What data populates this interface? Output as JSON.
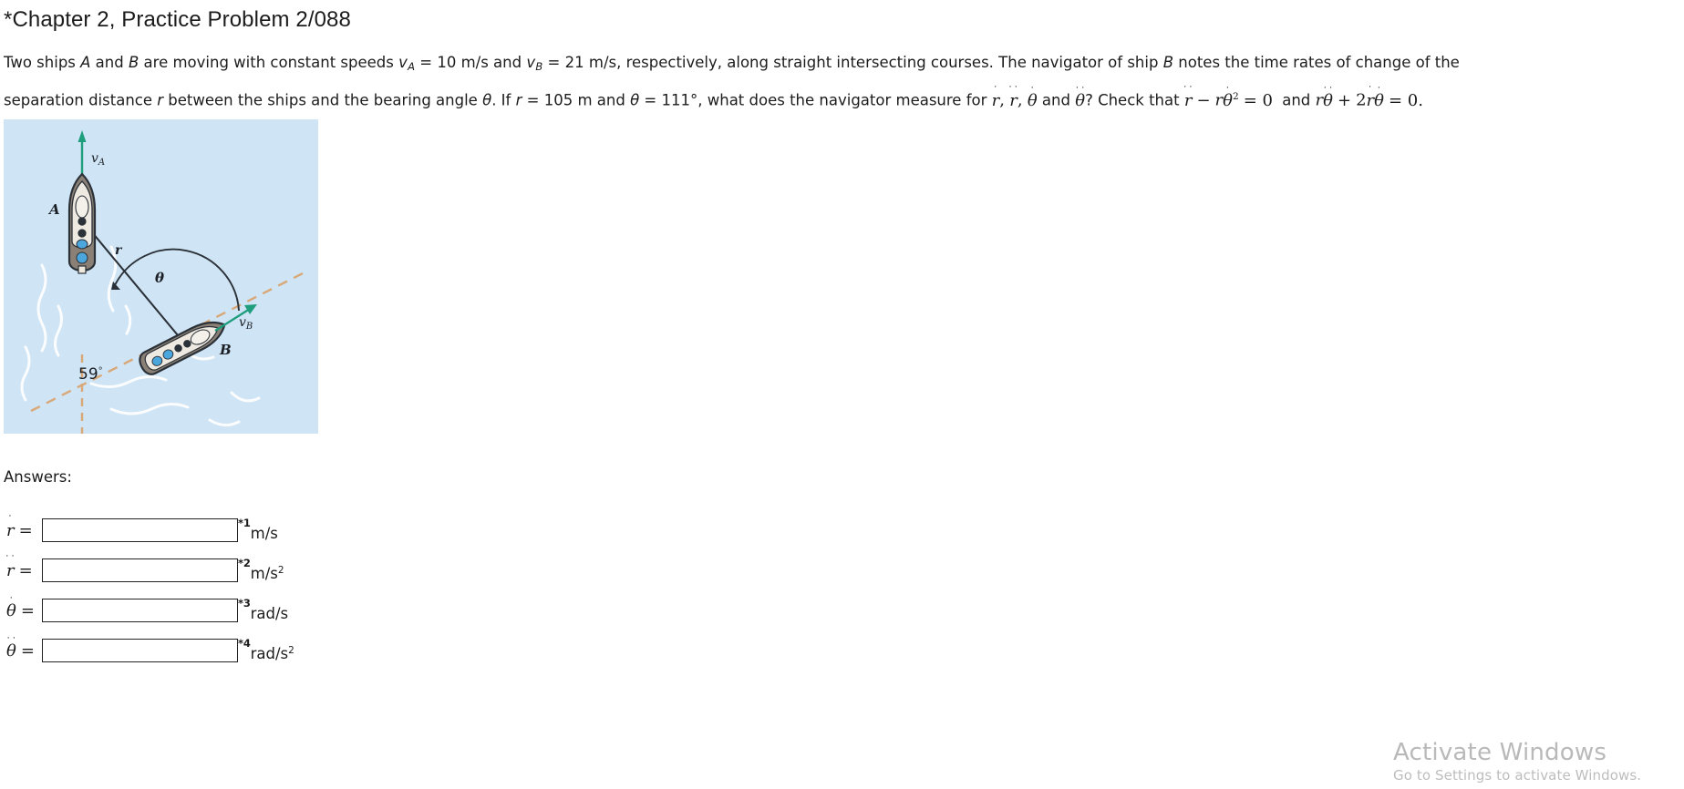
{
  "title": "*Chapter 2, Practice Problem 2/088",
  "problem": {
    "seg1": "Two ships ",
    "shipA": "A",
    "seg2": " and ",
    "shipB": "B",
    "seg3": " are moving with constant speeds ",
    "vA_var": "v",
    "vA_sub": "A",
    "seg4": " = 10 m/s and ",
    "vB_var": "v",
    "vB_sub": "B",
    "seg5": " = 21 m/s, respectively, along straight intersecting courses. The navigator of ship ",
    "shipB2": "B",
    "seg6": " notes the time rates of change of the",
    "seg7": "separation distance ",
    "r_var": "r",
    "seg8": " between the ships and the bearing angle ",
    "theta_var": "θ",
    "seg9": ". If ",
    "r_var2": "r",
    "seg10": " = 105 m and ",
    "theta_var2": "θ",
    "seg11": " = 111°, what does the navigator measure for ",
    "math_rdot": "r",
    "math_comma1": ",",
    "math_rddot": "r",
    "math_comma2": ",",
    "math_thetadot": "θ",
    "seg12": " and ",
    "math_thetaddot": "θ",
    "seg13": "? Check that ",
    "eq1_rddot": "r",
    "eq1_minus": "−",
    "eq1_r": "r",
    "eq1_thetadot": "θ",
    "eq1_sup": "2",
    "eq1_eq": "= 0",
    "seg14": " and ",
    "eq2_r": "r",
    "eq2_thetaddot": "θ",
    "eq2_plus": "+",
    "eq2_two": "2",
    "eq2_rdot": "r",
    "eq2_thetadot": "θ",
    "eq2_eq": "= 0."
  },
  "figure": {
    "label_vA": "v",
    "label_vA_sub": "A",
    "label_vB": "v",
    "label_vB_sub": "B",
    "label_A": "A",
    "label_B": "B",
    "label_r": "r",
    "label_theta": "θ",
    "label_angle": "59",
    "label_angle_deg": "°",
    "colors": {
      "water": "#cfe4f4",
      "arrow": "#1f9e7e",
      "dashed_course": "#d9a878",
      "hull": "#7d736a",
      "deck": "#e9e4dc",
      "window": "#4aa6dd",
      "line": "#2b3138",
      "wake": "#ffffff"
    }
  },
  "answers": {
    "heading": "Answers:",
    "rows": [
      {
        "symbol_base": "r",
        "dots": "˙",
        "marker": "*1",
        "units": "m/s",
        "units_sup": "",
        "value": "",
        "placeholder": ""
      },
      {
        "symbol_base": "r",
        "dots": "˙˙",
        "marker": "*2",
        "units": "m/s",
        "units_sup": "2",
        "value": "",
        "placeholder": ""
      },
      {
        "symbol_base": "θ",
        "dots": "˙",
        "marker": "*3",
        "units": "rad/s",
        "units_sup": "",
        "value": "",
        "placeholder": ""
      },
      {
        "symbol_base": "θ",
        "dots": "˙˙",
        "marker": "*4",
        "units": "rad/s",
        "units_sup": "2",
        "value": "",
        "placeholder": ""
      }
    ]
  },
  "watermark": {
    "title": "Activate Windows",
    "subtitle": "Go to Settings to activate Windows."
  }
}
